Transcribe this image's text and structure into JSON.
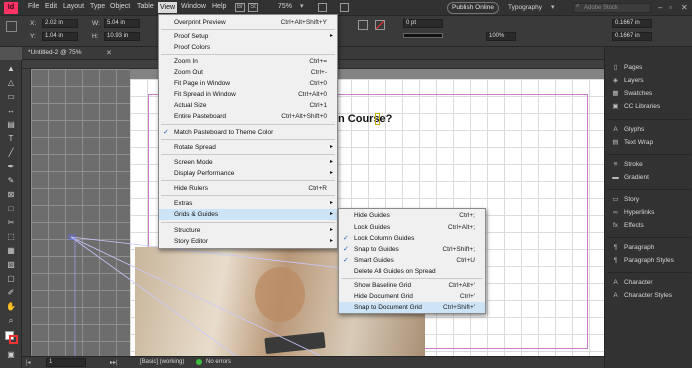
{
  "menubar": {
    "logo": "Id",
    "items": [
      "File",
      "Edit",
      "Layout",
      "Type",
      "Object",
      "Table",
      "View",
      "Window",
      "Help"
    ],
    "zoom": "75%",
    "publish": "Publish Online",
    "workspace": "Typography",
    "search_placeholder": "Adobe Stock"
  },
  "control": {
    "x_label": "X:",
    "x_value": "2.02 in",
    "y_label": "Y:",
    "y_value": "1.04 in",
    "w_label": "W:",
    "w_value": "5.04 in",
    "h_label": "H:",
    "h_value": "10.93 in",
    "stroke_value": "0 pt",
    "percent1": "100%",
    "gap_value": "0.1667 in",
    "gap_value2": "0.1667 in"
  },
  "document": {
    "tab_label": "*Untitled-2 @ 75%"
  },
  "canvas": {
    "heading_fragment": "n Course?"
  },
  "status": {
    "page": "1",
    "style": "[Basic] (working)",
    "errors": "No errors"
  },
  "view_menu": {
    "items": [
      {
        "label": "Overprint Preview",
        "shortcut": "Ctrl+Alt+Shift+Y"
      },
      {
        "label": "Proof Setup",
        "arrow": true
      },
      {
        "label": "Proof Colors"
      },
      {
        "label": "Zoom In",
        "shortcut": "Ctrl+="
      },
      {
        "label": "Zoom Out",
        "shortcut": "Ctrl+-"
      },
      {
        "label": "Fit Page in Window",
        "shortcut": "Ctrl+0"
      },
      {
        "label": "Fit Spread in Window",
        "shortcut": "Ctrl+Alt+0"
      },
      {
        "label": "Actual Size",
        "shortcut": "Ctrl+1"
      },
      {
        "label": "Entire Pasteboard",
        "shortcut": "Ctrl+Alt+Shift+0"
      },
      {
        "label": "Match Pasteboard to Theme Color",
        "checked": true
      },
      {
        "label": "Rotate Spread",
        "arrow": true
      },
      {
        "label": "Screen Mode",
        "arrow": true
      },
      {
        "label": "Display Performance",
        "arrow": true
      },
      {
        "label": "Hide Rulers",
        "shortcut": "Ctrl+R"
      },
      {
        "label": "Extras",
        "arrow": true
      },
      {
        "label": "Grids & Guides",
        "arrow": true,
        "highlighted": true
      },
      {
        "label": "Structure",
        "arrow": true
      },
      {
        "label": "Story Editor",
        "arrow": true
      }
    ]
  },
  "grids_menu": {
    "items": [
      {
        "label": "Hide Guides",
        "shortcut": "Ctrl+;"
      },
      {
        "label": "Lock Guides",
        "shortcut": "Ctrl+Alt+;"
      },
      {
        "label": "Lock Column Guides",
        "checked": true
      },
      {
        "label": "Snap to Guides",
        "shortcut": "Ctrl+Shift+;",
        "checked": true
      },
      {
        "label": "Smart Guides",
        "shortcut": "Ctrl+U",
        "checked": true
      },
      {
        "label": "Delete All Guides on Spread"
      },
      {
        "label": "Show Baseline Grid",
        "shortcut": "Ctrl+Alt+'"
      },
      {
        "label": "Hide Document Grid",
        "shortcut": "Ctrl+'"
      },
      {
        "label": "Snap to Document Grid",
        "shortcut": "Ctrl+Shift+'",
        "highlighted": true
      }
    ]
  },
  "panels": [
    {
      "label": "Pages",
      "icon": "pages-icon",
      "glyph": "▯"
    },
    {
      "label": "Layers",
      "icon": "layers-icon",
      "glyph": "◈"
    },
    {
      "label": "Swatches",
      "icon": "swatches-icon",
      "glyph": "▦"
    },
    {
      "label": "CC Libraries",
      "icon": "libraries-icon",
      "glyph": "▣"
    },
    {
      "label": "Glyphs",
      "icon": "glyphs-icon",
      "glyph": "A"
    },
    {
      "label": "Text Wrap",
      "icon": "text-wrap-icon",
      "glyph": "▤"
    },
    {
      "label": "Stroke",
      "icon": "stroke-icon",
      "glyph": "≡"
    },
    {
      "label": "Gradient",
      "icon": "gradient-icon",
      "glyph": "▬"
    },
    {
      "label": "Story",
      "icon": "story-icon",
      "glyph": "▭"
    },
    {
      "label": "Hyperlinks",
      "icon": "hyperlinks-icon",
      "glyph": "∞"
    },
    {
      "label": "Effects",
      "icon": "effects-icon",
      "glyph": "fx"
    },
    {
      "label": "Paragraph",
      "icon": "paragraph-icon",
      "glyph": "¶"
    },
    {
      "label": "Paragraph Styles",
      "icon": "paragraph-styles-icon",
      "glyph": "¶"
    },
    {
      "label": "Character",
      "icon": "character-icon",
      "glyph": "A"
    },
    {
      "label": "Character Styles",
      "icon": "character-styles-icon",
      "glyph": "A"
    }
  ],
  "colors": {
    "accent_magenta": "#c77dc9",
    "highlight": "#cde4f7",
    "check": "#1a5fb4",
    "logo": "#ff3366"
  }
}
